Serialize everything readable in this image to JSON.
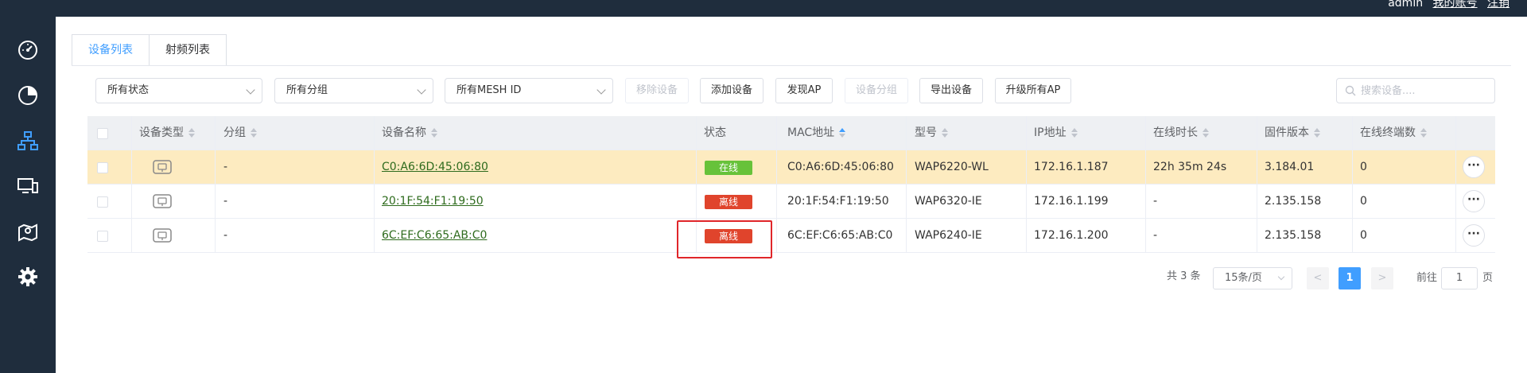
{
  "header": {
    "user": "admin",
    "account_link": "我的账号",
    "logout_link": "注销"
  },
  "sidebar": {
    "items": [
      {
        "icon": "dashboard-icon",
        "active": false
      },
      {
        "icon": "pie-chart-icon",
        "active": false
      },
      {
        "icon": "network-topology-icon",
        "active": true
      },
      {
        "icon": "devices-icon",
        "active": false
      },
      {
        "icon": "map-location-icon",
        "active": false
      },
      {
        "icon": "gear-icon",
        "active": false
      }
    ]
  },
  "tabs": [
    {
      "label": "设备列表",
      "active": true
    },
    {
      "label": "射频列表",
      "active": false
    }
  ],
  "toolbar": {
    "status_filter": "所有状态",
    "group_filter": "所有分组",
    "mesh_filter": "所有MESH ID",
    "remove_device": "移除设备",
    "add_device": "添加设备",
    "discover_ap": "发现AP",
    "device_group": "设备分组",
    "export_device": "导出设备",
    "upgrade_all_ap": "升级所有AP",
    "search_placeholder": "搜索设备...."
  },
  "table": {
    "columns": {
      "device_type": "设备类型",
      "group": "分组",
      "device_name": "设备名称",
      "status": "状态",
      "mac": "MAC地址",
      "model": "型号",
      "ip": "IP地址",
      "uptime": "在线时长",
      "firmware": "固件版本",
      "clients": "在线终端数"
    },
    "rows": [
      {
        "group": "-",
        "name": "C0:A6:6D:45:06:80",
        "status": "在线",
        "mac": "C0:A6:6D:45:06:80",
        "model": "WAP6220-WL",
        "ip": "172.16.1.187",
        "uptime": "22h 35m 24s",
        "firmware": "3.184.01",
        "clients": "0",
        "highlighted": true
      },
      {
        "group": "-",
        "name": "20:1F:54:F1:19:50",
        "status": "离线",
        "mac": "20:1F:54:F1:19:50",
        "model": "WAP6320-IE",
        "ip": "172.16.1.199",
        "uptime": "-",
        "firmware": "2.135.158",
        "clients": "0",
        "highlighted": false
      },
      {
        "group": "-",
        "name": "6C:EF:C6:65:AB:C0",
        "status": "离线",
        "mac": "6C:EF:C6:65:AB:C0",
        "model": "WAP6240-IE",
        "ip": "172.16.1.200",
        "uptime": "-",
        "firmware": "2.135.158",
        "clients": "0",
        "highlighted": false
      }
    ],
    "more_label": "···"
  },
  "pagination": {
    "total": "共 3 条",
    "page_size": "15条/页",
    "prev": "<",
    "current": "1",
    "next": ">",
    "goto_label": "前往",
    "goto_value": "1",
    "page_suffix": "页"
  },
  "colors": {
    "sidebar_bg": "#1f2d3d",
    "accent": "#409eff",
    "online": "#67c23a",
    "offline": "#e0442c",
    "highlight_row": "#fdebc0",
    "annotation_box": "#e0262a"
  }
}
